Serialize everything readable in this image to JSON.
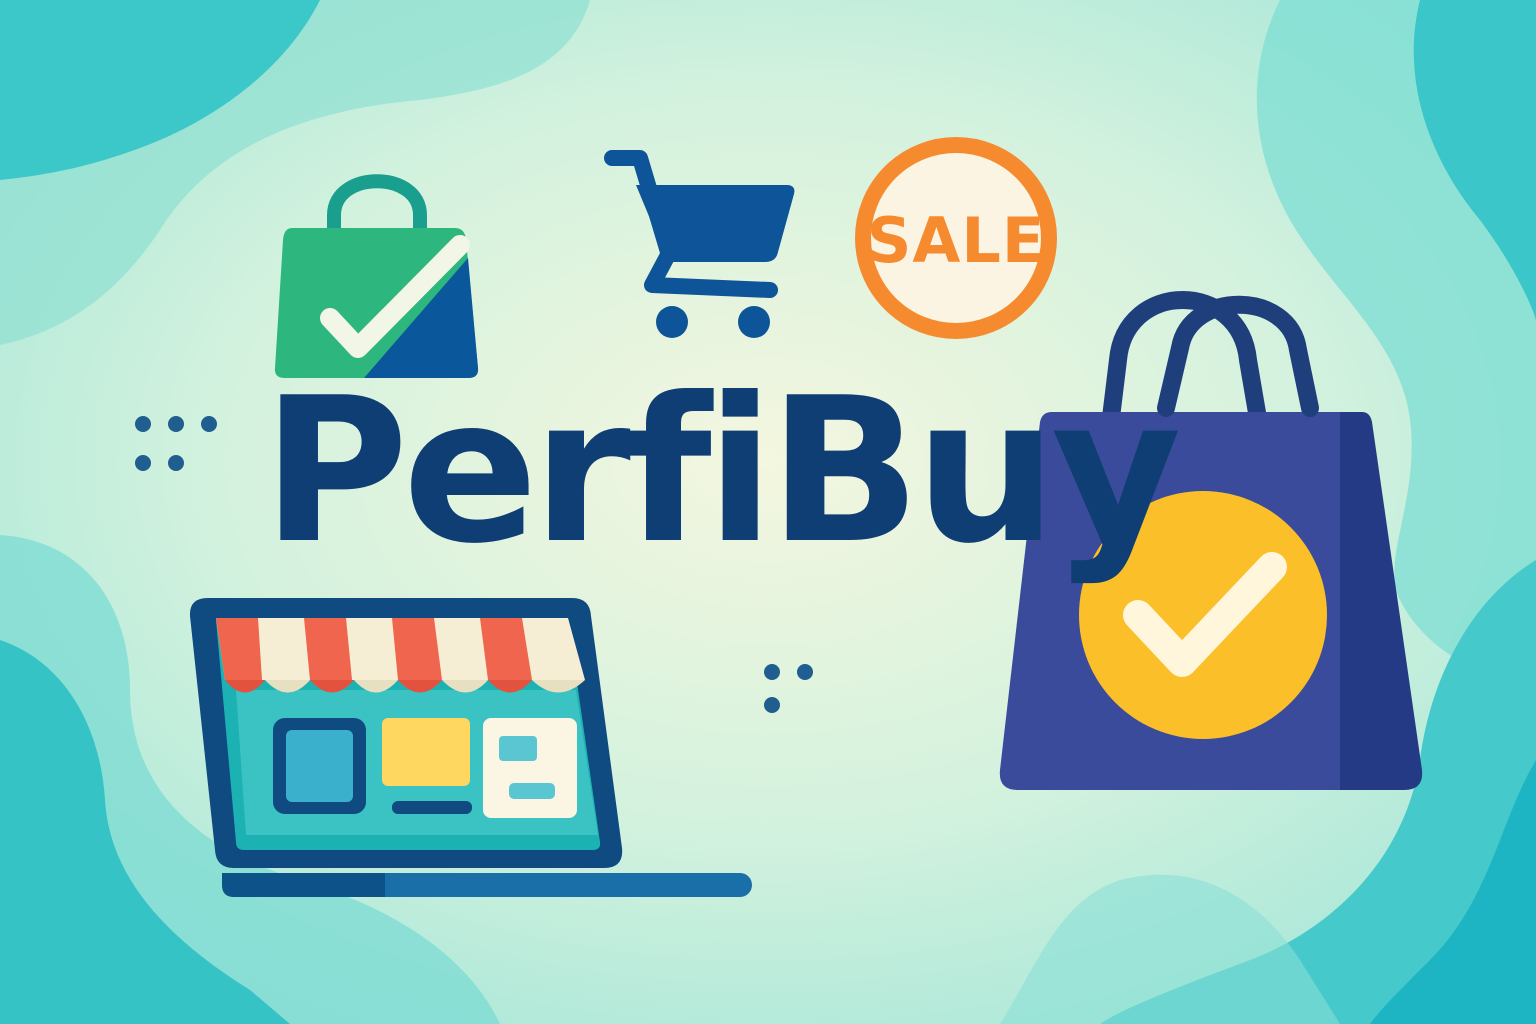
{
  "brand": {
    "name": "PerfiBuy"
  },
  "sale_badge": {
    "label": "SALE"
  },
  "icons": [
    "shopping-bag-check-icon",
    "shopping-cart-icon",
    "sale-badge-icon",
    "laptop-storefront-icon",
    "large-shopping-bag-check-icon",
    "decorative-dots"
  ],
  "colors": {
    "background_light": "#F2F5DE",
    "background_teal": "#2EC4C6",
    "brand_text": "#0E3E73",
    "bag_green": "#2DB77E",
    "bag_navy": "#0B579C",
    "cart_blue": "#0E5498",
    "sale_orange": "#F58B2E",
    "sale_fill": "#FBF4E2",
    "big_bag_indigo": "#394B9A",
    "big_bag_dark": "#243A84",
    "check_circle_yellow": "#FBBF2A",
    "awning_red": "#F0654E",
    "awning_cream": "#F5EED5"
  }
}
